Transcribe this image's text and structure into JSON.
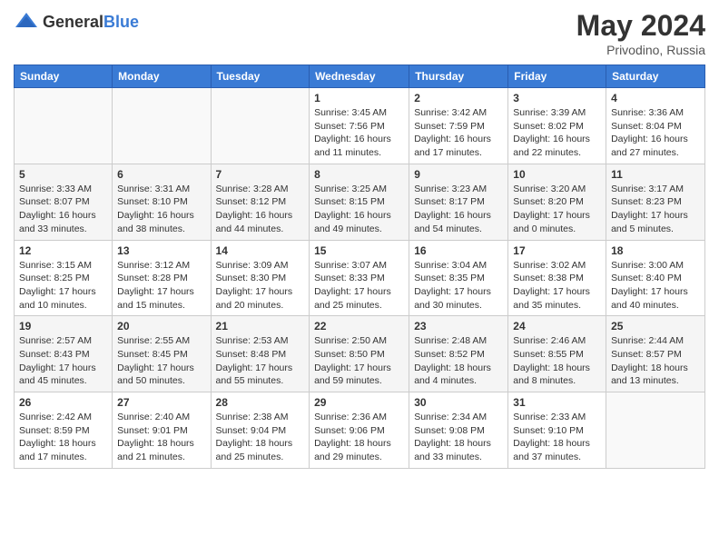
{
  "header": {
    "logo_general": "General",
    "logo_blue": "Blue",
    "title": "May 2024",
    "location": "Privodino, Russia"
  },
  "weekdays": [
    "Sunday",
    "Monday",
    "Tuesday",
    "Wednesday",
    "Thursday",
    "Friday",
    "Saturday"
  ],
  "weeks": [
    [
      {
        "day": "",
        "info": ""
      },
      {
        "day": "",
        "info": ""
      },
      {
        "day": "",
        "info": ""
      },
      {
        "day": "1",
        "info": "Sunrise: 3:45 AM\nSunset: 7:56 PM\nDaylight: 16 hours and 11 minutes."
      },
      {
        "day": "2",
        "info": "Sunrise: 3:42 AM\nSunset: 7:59 PM\nDaylight: 16 hours and 17 minutes."
      },
      {
        "day": "3",
        "info": "Sunrise: 3:39 AM\nSunset: 8:02 PM\nDaylight: 16 hours and 22 minutes."
      },
      {
        "day": "4",
        "info": "Sunrise: 3:36 AM\nSunset: 8:04 PM\nDaylight: 16 hours and 27 minutes."
      }
    ],
    [
      {
        "day": "5",
        "info": "Sunrise: 3:33 AM\nSunset: 8:07 PM\nDaylight: 16 hours and 33 minutes."
      },
      {
        "day": "6",
        "info": "Sunrise: 3:31 AM\nSunset: 8:10 PM\nDaylight: 16 hours and 38 minutes."
      },
      {
        "day": "7",
        "info": "Sunrise: 3:28 AM\nSunset: 8:12 PM\nDaylight: 16 hours and 44 minutes."
      },
      {
        "day": "8",
        "info": "Sunrise: 3:25 AM\nSunset: 8:15 PM\nDaylight: 16 hours and 49 minutes."
      },
      {
        "day": "9",
        "info": "Sunrise: 3:23 AM\nSunset: 8:17 PM\nDaylight: 16 hours and 54 minutes."
      },
      {
        "day": "10",
        "info": "Sunrise: 3:20 AM\nSunset: 8:20 PM\nDaylight: 17 hours and 0 minutes."
      },
      {
        "day": "11",
        "info": "Sunrise: 3:17 AM\nSunset: 8:23 PM\nDaylight: 17 hours and 5 minutes."
      }
    ],
    [
      {
        "day": "12",
        "info": "Sunrise: 3:15 AM\nSunset: 8:25 PM\nDaylight: 17 hours and 10 minutes."
      },
      {
        "day": "13",
        "info": "Sunrise: 3:12 AM\nSunset: 8:28 PM\nDaylight: 17 hours and 15 minutes."
      },
      {
        "day": "14",
        "info": "Sunrise: 3:09 AM\nSunset: 8:30 PM\nDaylight: 17 hours and 20 minutes."
      },
      {
        "day": "15",
        "info": "Sunrise: 3:07 AM\nSunset: 8:33 PM\nDaylight: 17 hours and 25 minutes."
      },
      {
        "day": "16",
        "info": "Sunrise: 3:04 AM\nSunset: 8:35 PM\nDaylight: 17 hours and 30 minutes."
      },
      {
        "day": "17",
        "info": "Sunrise: 3:02 AM\nSunset: 8:38 PM\nDaylight: 17 hours and 35 minutes."
      },
      {
        "day": "18",
        "info": "Sunrise: 3:00 AM\nSunset: 8:40 PM\nDaylight: 17 hours and 40 minutes."
      }
    ],
    [
      {
        "day": "19",
        "info": "Sunrise: 2:57 AM\nSunset: 8:43 PM\nDaylight: 17 hours and 45 minutes."
      },
      {
        "day": "20",
        "info": "Sunrise: 2:55 AM\nSunset: 8:45 PM\nDaylight: 17 hours and 50 minutes."
      },
      {
        "day": "21",
        "info": "Sunrise: 2:53 AM\nSunset: 8:48 PM\nDaylight: 17 hours and 55 minutes."
      },
      {
        "day": "22",
        "info": "Sunrise: 2:50 AM\nSunset: 8:50 PM\nDaylight: 17 hours and 59 minutes."
      },
      {
        "day": "23",
        "info": "Sunrise: 2:48 AM\nSunset: 8:52 PM\nDaylight: 18 hours and 4 minutes."
      },
      {
        "day": "24",
        "info": "Sunrise: 2:46 AM\nSunset: 8:55 PM\nDaylight: 18 hours and 8 minutes."
      },
      {
        "day": "25",
        "info": "Sunrise: 2:44 AM\nSunset: 8:57 PM\nDaylight: 18 hours and 13 minutes."
      }
    ],
    [
      {
        "day": "26",
        "info": "Sunrise: 2:42 AM\nSunset: 8:59 PM\nDaylight: 18 hours and 17 minutes."
      },
      {
        "day": "27",
        "info": "Sunrise: 2:40 AM\nSunset: 9:01 PM\nDaylight: 18 hours and 21 minutes."
      },
      {
        "day": "28",
        "info": "Sunrise: 2:38 AM\nSunset: 9:04 PM\nDaylight: 18 hours and 25 minutes."
      },
      {
        "day": "29",
        "info": "Sunrise: 2:36 AM\nSunset: 9:06 PM\nDaylight: 18 hours and 29 minutes."
      },
      {
        "day": "30",
        "info": "Sunrise: 2:34 AM\nSunset: 9:08 PM\nDaylight: 18 hours and 33 minutes."
      },
      {
        "day": "31",
        "info": "Sunrise: 2:33 AM\nSunset: 9:10 PM\nDaylight: 18 hours and 37 minutes."
      },
      {
        "day": "",
        "info": ""
      }
    ]
  ]
}
